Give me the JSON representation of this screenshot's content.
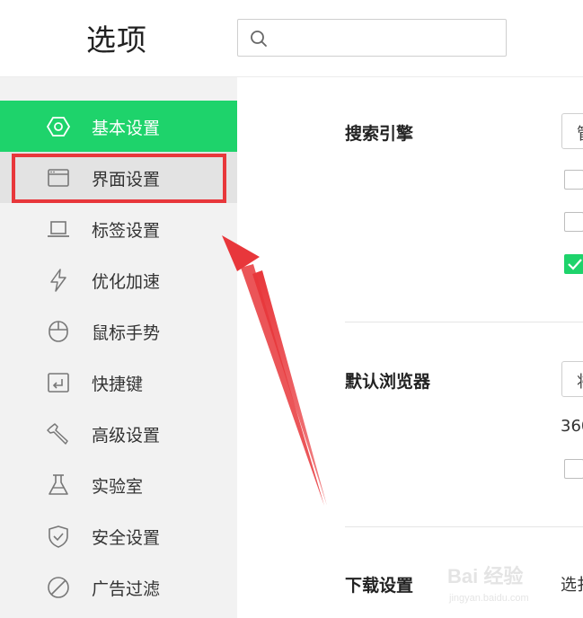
{
  "header": {
    "title": "选项",
    "search_placeholder": ""
  },
  "sidebar": {
    "items": [
      {
        "label": "基本设置",
        "icon": "hexagon-gear-icon"
      },
      {
        "label": "界面设置",
        "icon": "window-icon"
      },
      {
        "label": "标签设置",
        "icon": "laptop-icon"
      },
      {
        "label": "优化加速",
        "icon": "lightning-icon"
      },
      {
        "label": "鼠标手势",
        "icon": "mouse-icon"
      },
      {
        "label": "快捷键",
        "icon": "keyboard-return-icon"
      },
      {
        "label": "高级设置",
        "icon": "wrench-icon"
      },
      {
        "label": "实验室",
        "icon": "flask-icon"
      },
      {
        "label": "安全设置",
        "icon": "shield-icon"
      },
      {
        "label": "广告过滤",
        "icon": "block-icon"
      }
    ],
    "active_index": 0,
    "highlighted_index": 1
  },
  "content": {
    "search_engine": {
      "label": "搜索引擎",
      "select_partial": "管",
      "checkboxes": [
        false,
        false,
        true
      ]
    },
    "default_browser": {
      "label": "默认浏览器",
      "select_partial": "将",
      "text_partial": "360",
      "checkboxes": [
        false
      ]
    },
    "download": {
      "label": "下载设置",
      "text_partial": "选扌"
    }
  },
  "watermark": {
    "line1": "Bai 经验",
    "line2": "jingyan.baidu.com"
  },
  "colors": {
    "accent": "#1ed36b",
    "annotation": "#e8373b",
    "sidebar_bg": "#f2f2f2"
  }
}
